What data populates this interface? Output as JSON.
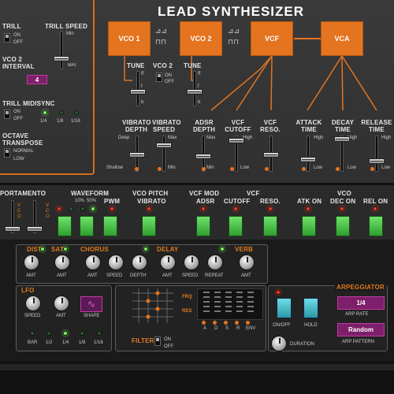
{
  "title": "LEAD SYNTHESIZER",
  "left_panel": {
    "trill": "TRILL",
    "trill_on": "ON",
    "trill_off": "OFF",
    "trill_speed": "TRILL SPEED",
    "trill_speed_min": "Min",
    "trill_speed_max": "MAX",
    "vco2_interval": "VCO 2 INTERVAL",
    "vco2_interval_value": "4",
    "trill_midisync": "TRILL MIDISYNC",
    "midisync_on": "ON",
    "midisync_off": "OFF",
    "div_labels": [
      "1/4",
      "1/8",
      "1/16"
    ],
    "octave_transpose": "OCTAVE TRANSPOSE",
    "normal": "NORMAL",
    "low": "LOW"
  },
  "blocks": [
    "VCO 1",
    "VCO 2",
    "VCF",
    "VCA"
  ],
  "sliders_top": {
    "tune1": "TUNE",
    "vco2": "VCO 2",
    "vco2_on": "ON",
    "vco2_off": "OFF",
    "tune2": "TUNE",
    "ff": "ff",
    "f": "f",
    "b": "b",
    "vibrato_depth": "VIBRATO DEPTH",
    "vibrato_speed": "VIBRATO SPEED",
    "adsr_depth": "ADSR DEPTH",
    "vcf_cutoff": "VCF CUTOFF",
    "vcf_reso": "VCF RESO.",
    "attack_time": "ATTACK TIME",
    "decay_time": "DECAY TIME",
    "release_time": "RELEASE TIME",
    "deep": "Deep",
    "shallow": "Shallow",
    "max": "Max",
    "min": "Min",
    "high": "High",
    "low": "Low"
  },
  "mid": {
    "portamento": "PORTAMENTO",
    "waveform": "WAVEFORM",
    "pct10": "10%",
    "pct50": "50%",
    "pwm": "PWM",
    "vco_pitch": "VCO PITCH",
    "vibrato": "VIBRATO",
    "vcf_mod": "VCF MOD",
    "vcf": "VCF",
    "adsr": "ADSR",
    "cutoff": "CUTOFF",
    "reso": "RESO.",
    "vco": "VCO",
    "atk_on": "ATK ON",
    "dec_on": "DEC ON",
    "rel_on": "REL ON"
  },
  "fx": {
    "dist": "DIST",
    "sat": "SAT",
    "chorus": "CHORUS",
    "delay": "DELAY",
    "verb": "VERB",
    "amt": "AMT",
    "speed": "SPEED",
    "depth": "DEPTH",
    "repeat": "REPEAT"
  },
  "lfo": {
    "title": "LFO",
    "speed": "SPEED",
    "amt": "AMT",
    "shape": "SHAPE",
    "bar": "BAR",
    "divs": [
      "1/2",
      "1/4",
      "1/8",
      "1/16"
    ]
  },
  "filter": {
    "filter": "FILTER",
    "on": "ON",
    "off": "OFF",
    "frq": "FRQ",
    "res": "RES",
    "adsr_letters": [
      "A",
      "D",
      "S",
      "R"
    ],
    "env": "ENV"
  },
  "arp": {
    "title": "ARPEGGIATOR",
    "onoff": "ON/OFF",
    "hold": "HOLD",
    "duration": "DURATION",
    "rate_value": "1/4",
    "rate_label": "ARP RATE",
    "pattern_value": "Random",
    "pattern_label": "ARP PATTERN"
  },
  "colors": {
    "accent": "#e47420",
    "led_green": "#7dff5a",
    "led_red": "#ff3a2a",
    "arp_select": "#7d1f6a"
  }
}
